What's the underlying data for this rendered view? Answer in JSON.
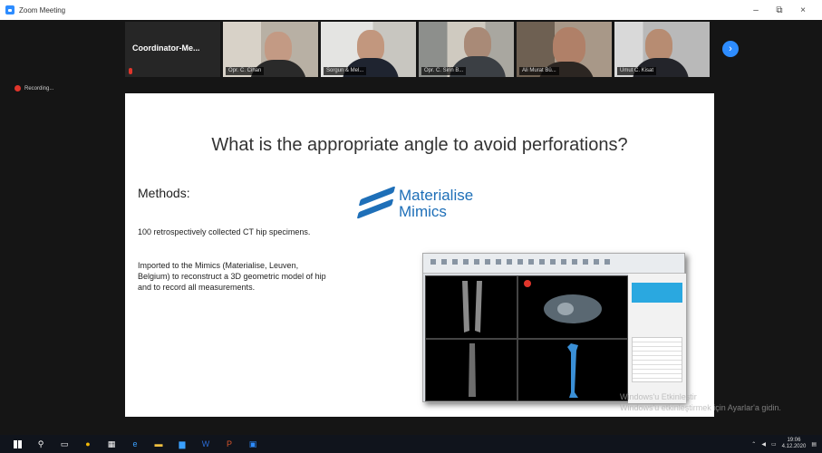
{
  "window": {
    "title": "Zoom Meeting",
    "minimize": "–",
    "maximize": "⧉",
    "close": "×"
  },
  "participants": [
    {
      "name": "Coordinator-Me...",
      "mic_muted": true
    },
    {
      "name": "Opr. C. Cihan",
      "mic_muted": true
    },
    {
      "name": "Sorgun & Mel...",
      "mic_muted": true
    },
    {
      "name": "Opr. C. Sirin B...",
      "mic_muted": true
    },
    {
      "name": "Ali Murat Bü...",
      "mic_muted": true
    },
    {
      "name": "Umut C. Kisat",
      "mic_muted": true
    }
  ],
  "next_page_icon": "›",
  "recording": {
    "label": "Recording..."
  },
  "slide": {
    "heading": "What is the appropriate angle to avoid perforations?",
    "methods": "Methods:",
    "bullet1": "100 retrospectively collected CT hip specimens.",
    "bullet2": "Imported to the Mimics (Materialise, Leuven, Belgium) to reconstruct a 3D geometric model of hip and to record all measurements.",
    "logo_line1": "Materialise",
    "logo_line2": "Mimics"
  },
  "watermark": {
    "line1": "Windows'u Etkinleştir",
    "line2": "Windows'u etkinleştirmek için Ayarlar'a gidin."
  },
  "taskbar": {
    "time": "19:06",
    "date": "4.12.2020"
  },
  "colors": {
    "accent": "#2d8cff",
    "recording": "#e0352b",
    "logo": "#1e6fb8"
  }
}
